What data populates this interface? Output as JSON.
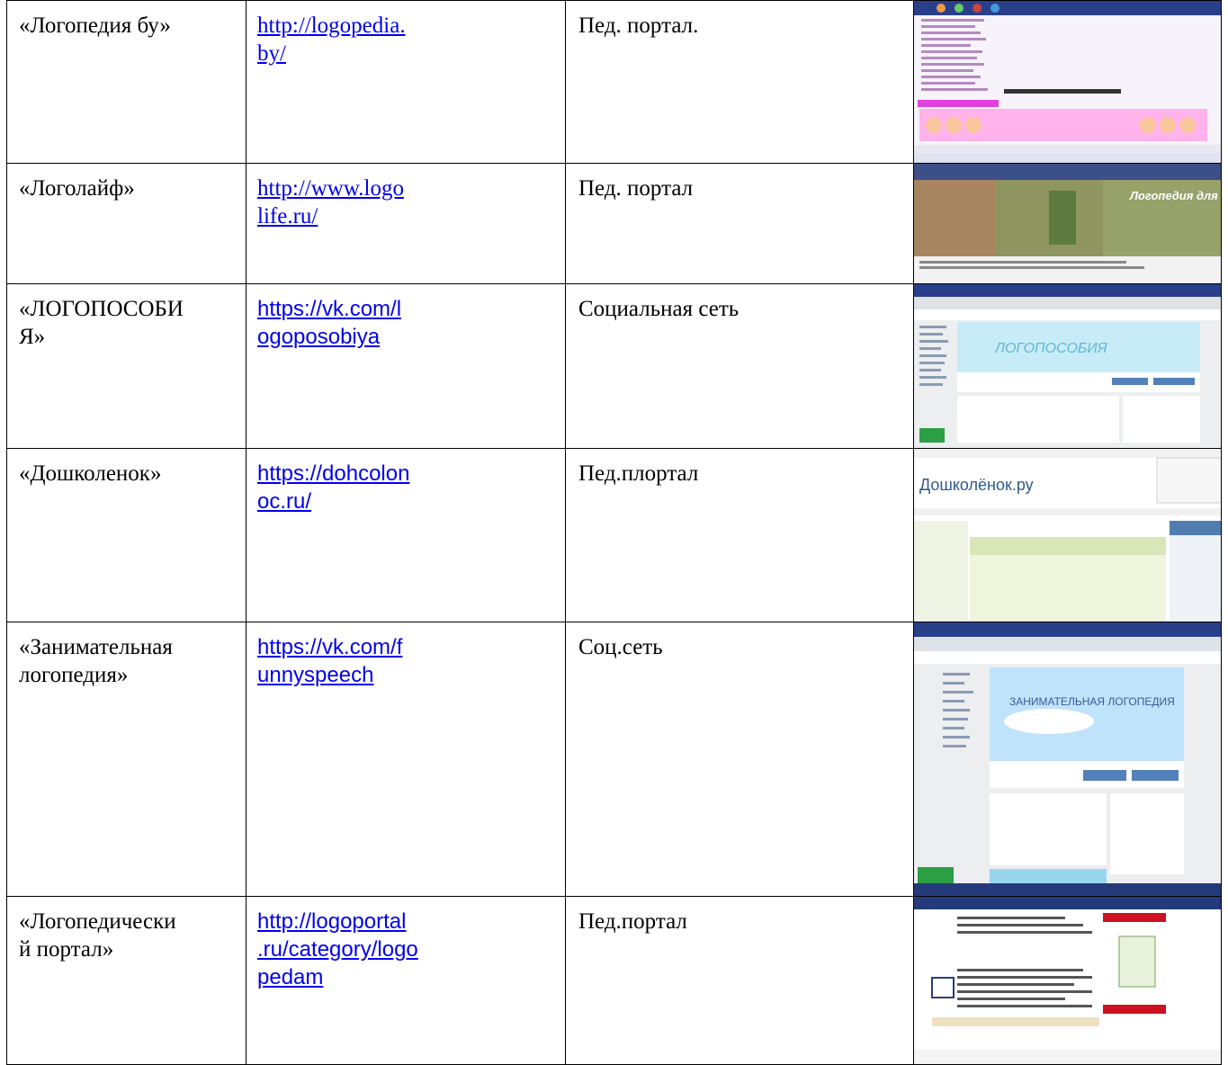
{
  "rows": [
    {
      "name": "«Логопедия бу»",
      "url": "http://logopedia.by/",
      "url_line1": "http://logopedia.",
      "url_line2": "by/",
      "type": "Пед. портал.",
      "thumbnail": "logopedia-screenshot-image"
    },
    {
      "name": "«Логолайф»",
      "url": "http://www.logolife.ru/",
      "url_line1": "http://www.logo",
      "url_line2": "life.ru/",
      "type": "Пед. портал",
      "thumbnail": "logolife-screenshot-image",
      "thumbnail_text": "Логопедия для всех"
    },
    {
      "name": "«ЛОГОПОСОБИЯ»",
      "name_line1": "«ЛОГОПОСОБИ",
      "name_line2": "Я»",
      "url": "https://vk.com/logoposobiya",
      "url_line1": "https://vk.com/l",
      "url_line2": "ogoposobiya",
      "type": "Социальная сеть",
      "thumbnail": "vk-logoposobiya-screenshot-image",
      "thumbnail_text": "ЛОГОПОСОБИЯ"
    },
    {
      "name": "«Дошколенок»",
      "url": "https://dohcolonoc.ru/",
      "url_line1": "https://dohcolon",
      "url_line2": "oc.ru/",
      "type": "Пед.плортал",
      "thumbnail": "doshkolenok-screenshot-image",
      "thumbnail_text": "Дошколёнок.ру"
    },
    {
      "name": "«Занимательная логопедия»",
      "name_line1": "«Занимательная",
      "name_line2": "логопедия»",
      "url": "https://vk.com/funnyspeech",
      "url_line1": "https://vk.com/f",
      "url_line2": "unnyspeech",
      "type": "Соц.сеть",
      "thumbnail": "vk-funnyspeech-screenshot-image",
      "thumbnail_text": "ЗАНИМАТЕЛЬНАЯ ЛОГОПЕДИЯ"
    },
    {
      "name": "«Логопедический портал»",
      "name_line1": "«Логопедически",
      "name_line2": "й портал»",
      "url": "http://logoportal.ru/category/logopedam",
      "url_line1": "http://logoportal",
      "url_line2": ".ru/category/logo",
      "url_line3": "pedam",
      "type": "Пед.портал",
      "thumbnail": "logoportal-screenshot-image"
    }
  ]
}
